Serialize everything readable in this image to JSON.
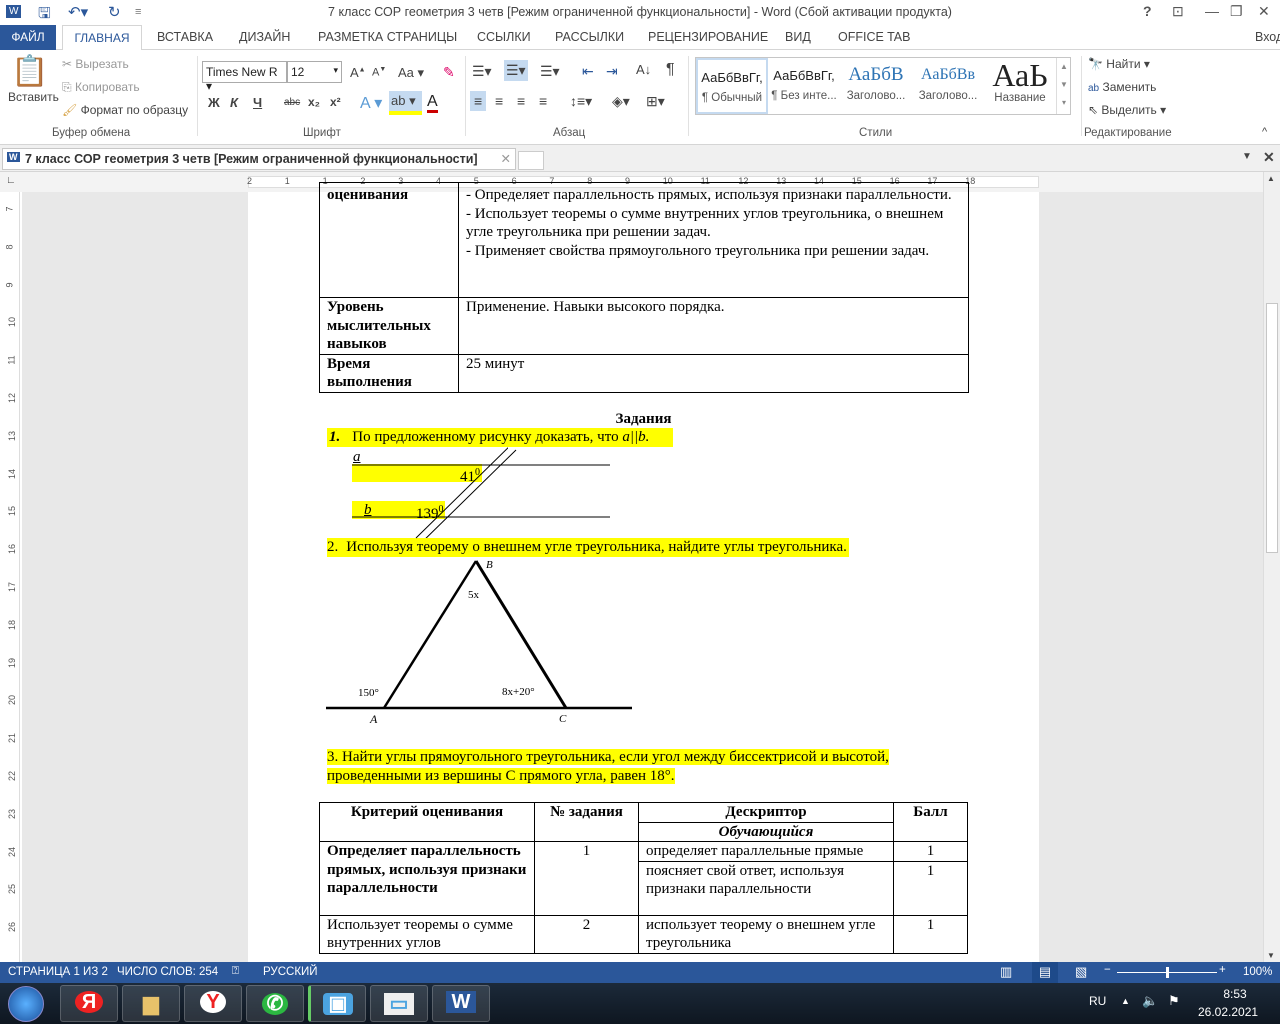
{
  "window": {
    "title": "7 класс СОР геометрия 3 четв [Режим ограниченной функциональности] - Word (Сбой активации продукта)",
    "signin": "Вход"
  },
  "tabs": [
    "ФАЙЛ",
    "ГЛАВНАЯ",
    "ВСТАВКА",
    "ДИЗАЙН",
    "РАЗМЕТКА СТРАНИЦЫ",
    "ССЫЛКИ",
    "РАССЫЛКИ",
    "РЕЦЕНЗИРОВАНИЕ",
    "ВИД",
    "OFFICE TAB"
  ],
  "ribbon": {
    "clipboard": {
      "paste": "Вставить",
      "cut": "Вырезать",
      "copy": "Копировать",
      "format_painter": "Формат по образцу",
      "label": "Буфер обмена"
    },
    "font": {
      "name": "Times New R",
      "size": "12",
      "label": "Шрифт",
      "bold": "Ж",
      "italic": "К",
      "underline": "Ч",
      "strike": "abc"
    },
    "paragraph": {
      "label": "Абзац"
    },
    "styles": {
      "label": "Стили",
      "items": [
        {
          "sample": "АаБбВвГг,",
          "name": "¶ Обычный"
        },
        {
          "sample": "АаБбВвГг,",
          "name": "¶ Без инте..."
        },
        {
          "sample": "АаБбВ",
          "name": "Заголово..."
        },
        {
          "sample": "АаБбВв",
          "name": "Заголово..."
        },
        {
          "sample": "АаЬ",
          "name": "Название"
        }
      ]
    },
    "editing": {
      "label": "Редактирование",
      "find": "Найти",
      "replace": "Заменить",
      "select": "Выделить"
    }
  },
  "doc_tab": "7 класс СОР геометрия 3 четв [Режим ограниченной функциональности]",
  "ruler": {
    "h": [
      "2",
      "1",
      "1",
      "2",
      "3",
      "4",
      "5",
      "6",
      "7",
      "8",
      "9",
      "10",
      "11",
      "12",
      "13",
      "14",
      "15",
      "16",
      "17",
      "18"
    ],
    "v": [
      "7",
      "8",
      "9",
      "10",
      "11",
      "12",
      "13",
      "14",
      "15",
      "16",
      "17",
      "18",
      "19",
      "20",
      "21",
      "22",
      "23",
      "24",
      "25",
      "26"
    ]
  },
  "top_table": [
    {
      "label": "оценивания",
      "content": [
        "- Определяет параллельность прямых, используя признаки параллельности.",
        "- Использует теоремы о сумме внутренних углов треугольника, о внешнем угле треугольника при решении задач.",
        "- Применяет свойства прямоугольного треугольника при решении задач."
      ]
    },
    {
      "label": "Уровень мыслительных навыков",
      "content": [
        "Применение. Навыки высокого порядка."
      ]
    },
    {
      "label": "Время выполнения",
      "content": [
        "25 минут"
      ]
    }
  ],
  "tasks": {
    "heading": "Задания",
    "t1": {
      "num": "1.",
      "text": "По предложенному рисунку доказать, что ",
      "math": "a||b.",
      "fig": {
        "a": "a",
        "b": "b",
        "angle1": "41",
        "angle2": "139",
        "deg": "0"
      }
    },
    "t2": {
      "num": "2.",
      "text": "Используя теорему о внешнем угле треугольника, найдите углы треугольника.",
      "fig": {
        "A": "A",
        "B": "B",
        "C": "C",
        "angleB": "5x",
        "angleA": "150°",
        "angleC": "8x+20°"
      }
    },
    "t3": "3. Найти углы прямоугольного треугольника, если угол между биссектрисой и высотой, проведенными из вершины С прямого угла, равен 18°."
  },
  "criteria": {
    "headers": {
      "criterion": "Критерий оценивания",
      "task": "№ задания",
      "descriptor": "Дескриптор",
      "learner": "Обучающийся",
      "score": "Балл"
    },
    "rows": [
      {
        "criterion": "Определяет параллельность прямых, используя признаки параллельности",
        "task": "1",
        "descriptors": [
          {
            "text": "определяет параллельные прямые",
            "score": "1"
          },
          {
            "text": "поясняет свой ответ, используя признаки параллельности",
            "score": "1"
          }
        ]
      },
      {
        "criterion": "Использует теоремы о сумме внутренних углов",
        "task": "2",
        "descriptors": [
          {
            "text": "использует теорему о внешнем угле треугольника",
            "score": "1"
          }
        ]
      }
    ]
  },
  "status": {
    "page": "СТРАНИЦА 1 ИЗ 2",
    "words": "ЧИСЛО СЛОВ: 254",
    "lang": "РУССКИЙ",
    "zoom": "100%",
    "zoom_percent": 100
  },
  "taskbar": {
    "lang": "RU",
    "time": "8:53",
    "date": "26.02.2021"
  }
}
